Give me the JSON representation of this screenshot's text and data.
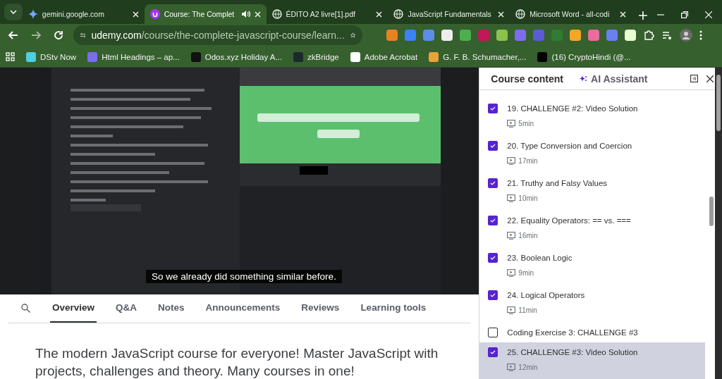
{
  "browser": {
    "tabs": [
      {
        "title": "gemini.google.com",
        "kind": "gemini",
        "selected": false,
        "playing": false
      },
      {
        "title": "Course: The Complet",
        "kind": "udemy",
        "selected": true,
        "playing": true
      },
      {
        "title": "ÉDITO A2 livre[1].pdf",
        "kind": "globe",
        "selected": false,
        "playing": false
      },
      {
        "title": "JavaScript Fundamentals",
        "kind": "globe",
        "selected": false,
        "playing": false
      },
      {
        "title": "Microsoft Word - all-codi",
        "kind": "globe",
        "selected": false,
        "playing": false
      }
    ],
    "address": {
      "host": "udemy.com",
      "path": "/course/the-complete-javascript-course/learn..."
    },
    "bookmarks": [
      {
        "label": "DStv Now",
        "color": "#4dd0e1"
      },
      {
        "label": "Html Headings – ap...",
        "color": "#7b6cf0"
      },
      {
        "label": "Odos.xyz Holiday A...",
        "color": "#111111"
      },
      {
        "label": "zkBridge",
        "color": "#1a2a2a"
      },
      {
        "label": "Adobe Acrobat",
        "color": "#ffffff"
      },
      {
        "label": "G. F. B. Schumacher,...",
        "color": "#e8a23a"
      },
      {
        "label": "(16) CryptoHindi (@...",
        "color": "#000000"
      }
    ]
  },
  "player": {
    "caption": "So we already did something similar before."
  },
  "course_tabs": [
    {
      "label": "Overview",
      "selected": true
    },
    {
      "label": "Q&A",
      "selected": false
    },
    {
      "label": "Notes",
      "selected": false
    },
    {
      "label": "Announcements",
      "selected": false
    },
    {
      "label": "Reviews",
      "selected": false
    },
    {
      "label": "Learning tools",
      "selected": false
    }
  ],
  "description": "The modern JavaScript course for everyone! Master JavaScript with projects, challenges and theory. Many courses in one!",
  "sidebar": {
    "tabs": [
      {
        "label": "Course content",
        "selected": true
      },
      {
        "label": "AI Assistant",
        "selected": false
      }
    ],
    "items": [
      {
        "title": "19. CHALLENGE #2: Video Solution",
        "duration": "5min",
        "checked": true,
        "selected": false
      },
      {
        "title": "20. Type Conversion and Coercion",
        "duration": "17min",
        "checked": true,
        "selected": false
      },
      {
        "title": "21. Truthy and Falsy Values",
        "duration": "10min",
        "checked": true,
        "selected": false
      },
      {
        "title": "22. Equality Operators: == vs. ===",
        "duration": "16min",
        "checked": true,
        "selected": false
      },
      {
        "title": "23. Boolean Logic",
        "duration": "9min",
        "checked": true,
        "selected": false
      },
      {
        "title": "24. Logical Operators",
        "duration": "11min",
        "checked": true,
        "selected": false
      },
      {
        "title": "Coding Exercise 3: CHALLENGE #3",
        "checked": false,
        "selected": false
      },
      {
        "title": "25. CHALLENGE #3: Video Solution",
        "duration": "12min",
        "checked": true,
        "selected": true
      }
    ]
  }
}
